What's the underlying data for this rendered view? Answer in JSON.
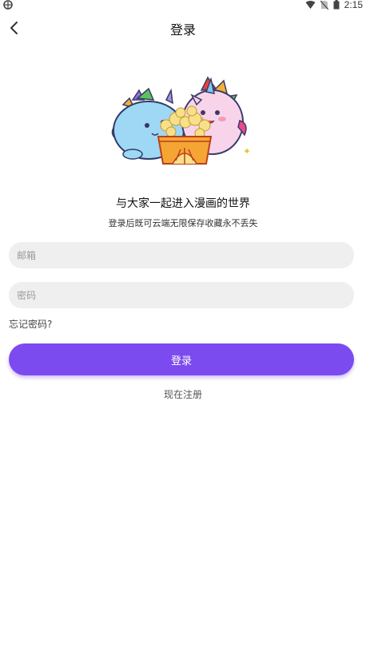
{
  "status_bar": {
    "time": "2:15",
    "icons": [
      "wifi-icon",
      "no-sim-icon",
      "battery-icon"
    ]
  },
  "header": {
    "title": "登录",
    "back_icon": "chevron-left-icon"
  },
  "intro": {
    "headline": "与大家一起进入漫画的世界",
    "subline": "登录后既可云端无限保存收藏永不丢失"
  },
  "form": {
    "email_placeholder": "邮箱",
    "email_value": "",
    "password_placeholder": "密码",
    "password_value": "",
    "forgot_label": "忘记密码?",
    "login_label": "登录",
    "register_label": "现在注册"
  },
  "colors": {
    "accent": "#7b4bf0",
    "field_bg": "#efefef"
  }
}
